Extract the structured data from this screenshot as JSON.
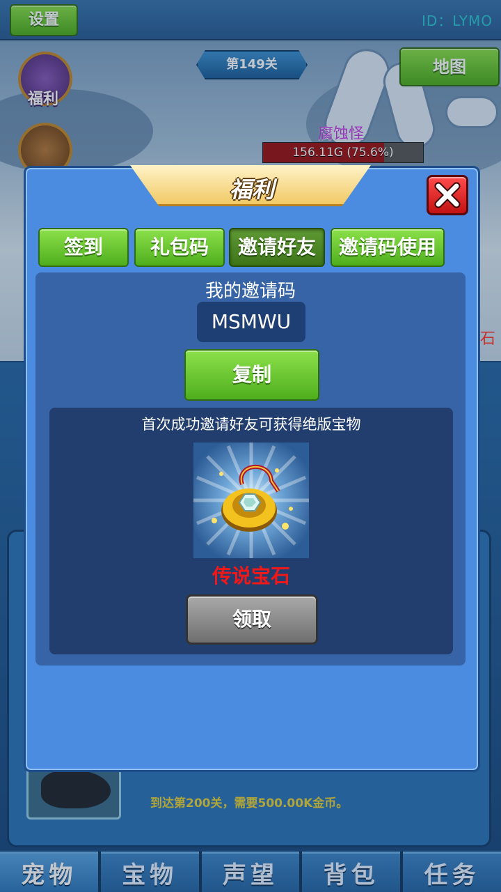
{
  "topbar": {
    "settings_label": "设置",
    "player_id": "ID：LYMO"
  },
  "scene": {
    "stage_label": "第149关",
    "map_label": "地图",
    "welfare_label": "福利",
    "monster_name": "腐蚀怪",
    "monster_hp_text": "156.11G (75.6%)",
    "monster_hp_fraction": 0.756,
    "edge_text": "石",
    "hint_text": "到达第200关，需要500.00K金币。"
  },
  "dialog": {
    "title": "福利",
    "tabs": [
      {
        "label": "签到"
      },
      {
        "label": "礼包码"
      },
      {
        "label": "邀请好友"
      },
      {
        "label": "邀请码使用"
      }
    ],
    "active_tab": "邀请好友",
    "my_code_label": "我的邀请码",
    "invite_code": "MSMWU",
    "copy_label": "复制",
    "reward_desc": "首次成功邀请好友可获得绝版宝物",
    "reward_icon": "amulet-gem-icon",
    "reward_name": "传说宝石",
    "claim_label": "领取"
  },
  "bottom_tabs": [
    {
      "label": "宠物"
    },
    {
      "label": "宝物"
    },
    {
      "label": "声望"
    },
    {
      "label": "背包"
    },
    {
      "label": "任务"
    }
  ],
  "colors": {
    "button_green": "#5fbf25",
    "dialog_blue": "#4c8ce0",
    "reward_red": "#f01818",
    "hp_red": "#9c1515",
    "monster_purple": "#c23fe0",
    "id_cyan": "#2ec6cf"
  }
}
